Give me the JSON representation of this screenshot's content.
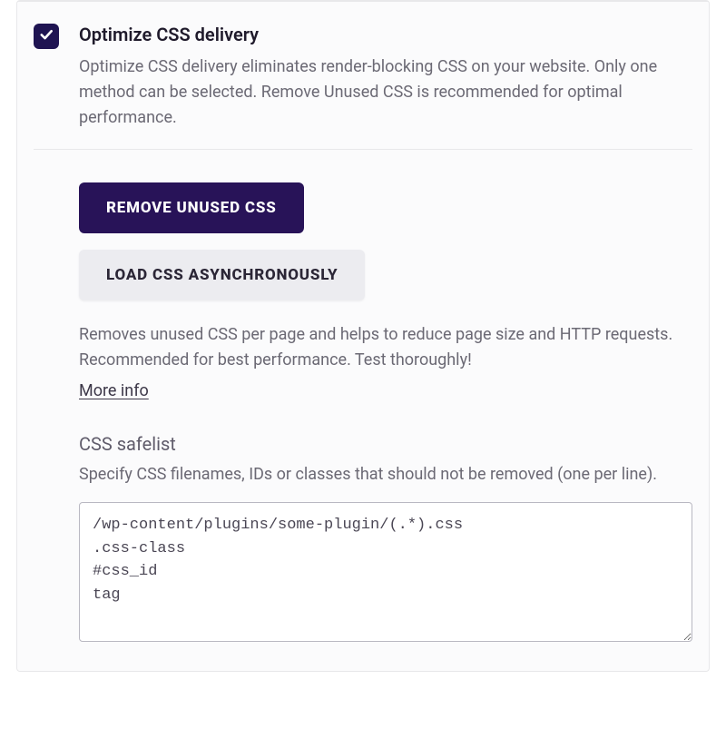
{
  "option": {
    "title": "Optimize CSS delivery",
    "description": "Optimize CSS delivery eliminates render-blocking CSS on your website. Only one method can be selected. Remove Unused CSS is recommended for optimal performance.",
    "checked": true
  },
  "buttons": {
    "remove_unused": "REMOVE UNUSED CSS",
    "load_async": "LOAD CSS ASYNCHRONOUSLY"
  },
  "method_description": "Removes unused CSS per page and helps to reduce page size and HTTP requests. Recommended for best performance. Test thoroughly!",
  "more_info_label": "More info",
  "safelist": {
    "title": "CSS safelist",
    "description": "Specify CSS filenames, IDs or classes that should not be removed (one per line).",
    "value": "/wp-content/plugins/some-plugin/(.*).css\n.css-class\n#css_id\ntag"
  }
}
